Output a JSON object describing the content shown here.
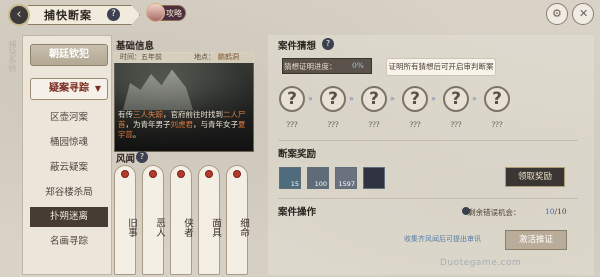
{
  "header": {
    "back_icon": "chevron-left-icon",
    "title": "捕快断案",
    "help": "?",
    "guide_label": "攻略"
  },
  "side_text": "捕快系统",
  "left_nav": {
    "categories": [
      {
        "label": "朝廷钦犯",
        "active": false
      },
      {
        "label": "疑案寻踪",
        "active": true
      }
    ],
    "items": [
      {
        "label": "区壶河案",
        "selected": false
      },
      {
        "label": "桶园惊魂",
        "selected": false
      },
      {
        "label": "蔽云疑案",
        "selected": false
      },
      {
        "label": "郑谷楼杀局",
        "selected": false
      },
      {
        "label": "扑朔迷离",
        "selected": true
      },
      {
        "label": "名画寻踪",
        "selected": false
      }
    ]
  },
  "basic_info": {
    "title": "基础信息",
    "time_label": "时间：五年前",
    "place_label": "地点：",
    "place_value": "鹏鹤洞",
    "story_parts": [
      {
        "text": "有传",
        "hl": false
      },
      {
        "text": "三人失踪",
        "hl": true
      },
      {
        "text": "，官府前往时找到",
        "hl": false
      },
      {
        "text": "二人尸首",
        "hl": true
      },
      {
        "text": "，为青年男子",
        "hl": false
      },
      {
        "text": "刘虎君",
        "hl": true
      },
      {
        "text": "，与青年女子",
        "hl": false
      },
      {
        "text": "夏宇蕊",
        "hl": true
      },
      {
        "text": "。",
        "hl": false
      }
    ]
  },
  "rumors": {
    "title": "风闻",
    "help": "?",
    "cards": [
      "旧事",
      "恶人",
      "侠者",
      "面具",
      "细命"
    ]
  },
  "case_guess": {
    "title": "案件猜想",
    "help": "?",
    "progress_label": "猜想证明进度：",
    "progress_value": "0%",
    "tip": "证明所有猜想后可开启审判断案",
    "nodes": [
      "?",
      "?",
      "?",
      "?",
      "?",
      "?"
    ],
    "node_caption": "???"
  },
  "rewards": {
    "title": "断案奖励",
    "items": [
      {
        "icon": "token-icon",
        "count": "15"
      },
      {
        "icon": "silver-icon",
        "count": "100"
      },
      {
        "icon": "coin-icon",
        "count": "1597"
      },
      {
        "icon": "box-icon",
        "count": ""
      }
    ],
    "claim_button": "领取奖励"
  },
  "case_ops": {
    "title": "案件操作",
    "remain_label": "剩余错误机会：",
    "remain_value": "10",
    "remain_total": "/10",
    "hint": "收集齐风闻后可提出审讯",
    "submit_button": "激活推证"
  },
  "watermark": "Duotegame.com"
}
